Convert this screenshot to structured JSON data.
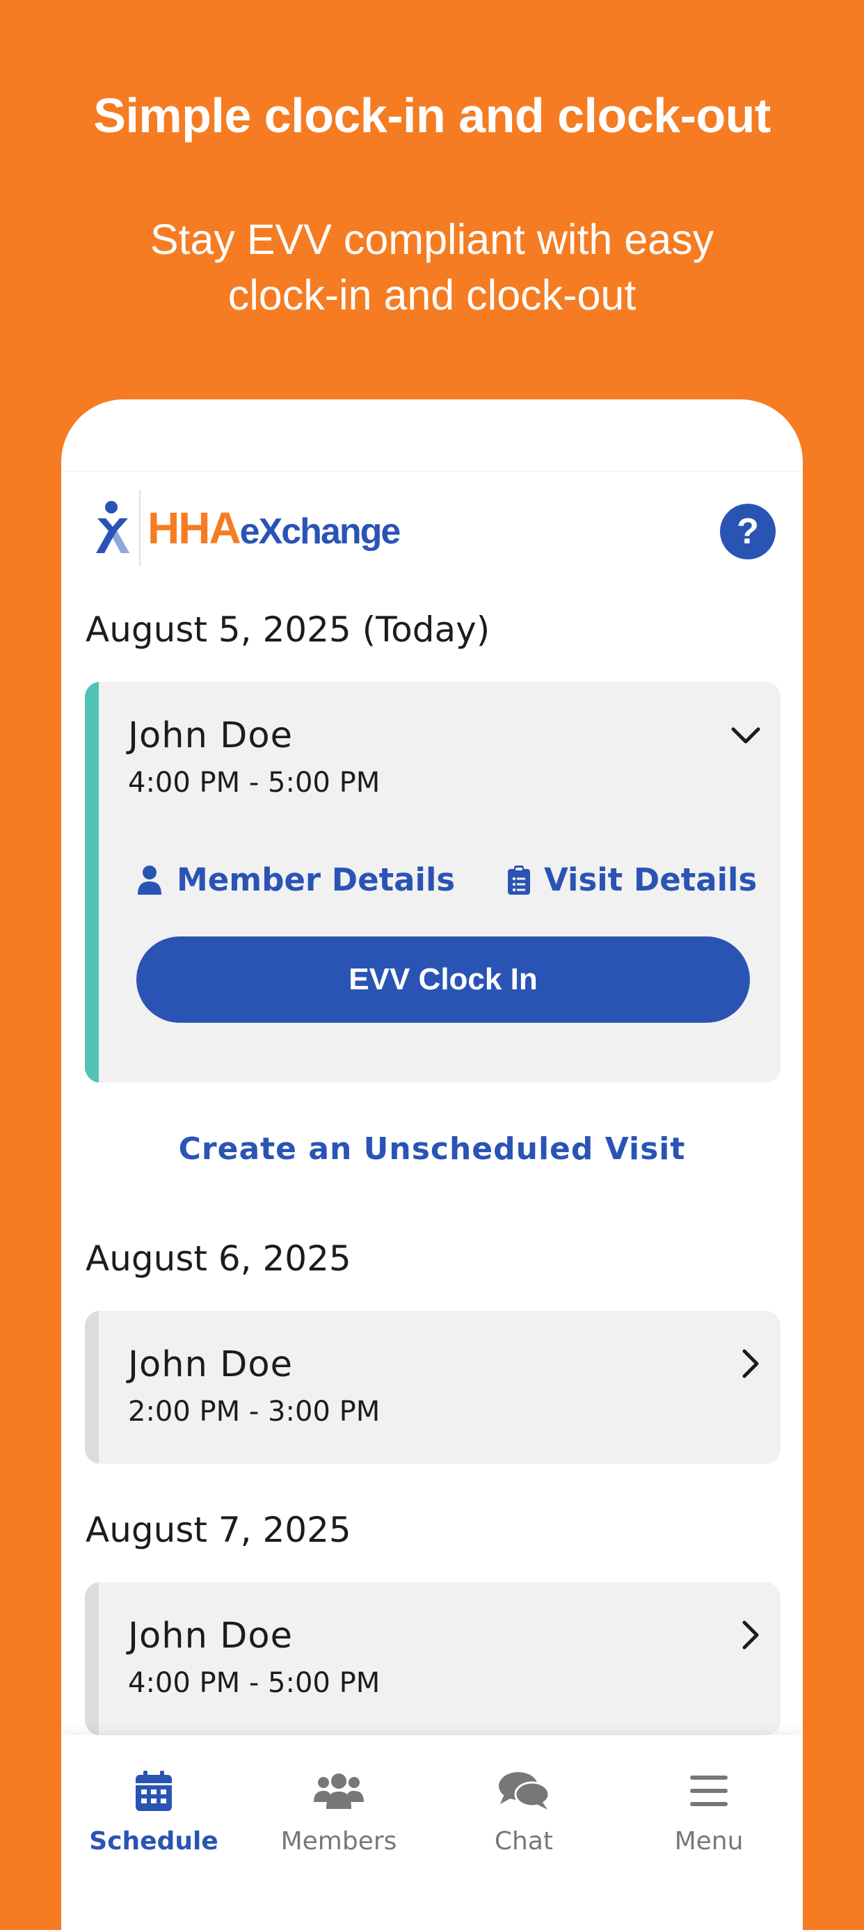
{
  "promo": {
    "headline": "Simple clock-in and clock-out",
    "subhead": "Stay EVV compliant with easy clock-in and clock-out"
  },
  "app": {
    "logo": {
      "brand_part1": "HHA",
      "brand_part2": "eXchange"
    },
    "help_label": "?",
    "colors": {
      "primary": "#2A54B4",
      "accent_orange": "#F57C22",
      "today_accent": "#52C2B5",
      "card_bg": "#F1F1F1"
    }
  },
  "schedule": {
    "days": [
      {
        "date_label": "August 5, 2025 (Today)",
        "visit": {
          "member_name": "John Doe",
          "time_range": "4:00 PM - 5:00 PM",
          "expanded": true,
          "chevron_icon": "chevron-down-icon",
          "member_details_label": "Member Details",
          "visit_details_label": "Visit Details",
          "clock_in_label": "EVV Clock In"
        }
      },
      {
        "date_label": "August 6, 2025",
        "visit": {
          "member_name": "John Doe",
          "time_range": "2:00 PM - 3:00 PM",
          "expanded": false,
          "chevron_icon": "chevron-right-icon"
        }
      },
      {
        "date_label": "August 7, 2025",
        "visit": {
          "member_name": "John Doe",
          "time_range": "4:00 PM - 5:00 PM",
          "expanded": false,
          "chevron_icon": "chevron-right-icon"
        }
      }
    ],
    "unscheduled_label": "Create an Unscheduled Visit"
  },
  "nav": {
    "items": [
      {
        "label": "Schedule",
        "icon": "calendar-icon",
        "active": true
      },
      {
        "label": "Members",
        "icon": "members-icon",
        "active": false
      },
      {
        "label": "Chat",
        "icon": "chat-icon",
        "active": false
      },
      {
        "label": "Menu",
        "icon": "menu-icon",
        "active": false
      }
    ]
  }
}
